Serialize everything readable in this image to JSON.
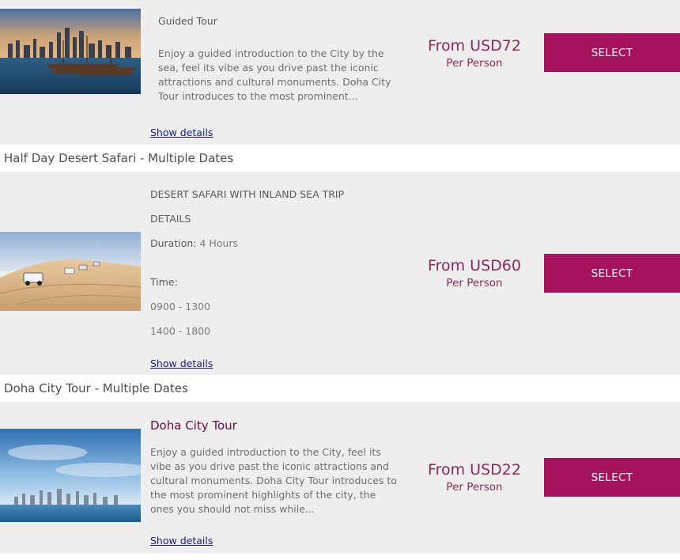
{
  "tours": [
    {
      "subtitle": "Guided Tour",
      "description": "Enjoy a guided introduction to the City by the sea, feel its vibe as you drive past the iconic attractions and cultural monuments. Doha City Tour introduces to the most prominent...",
      "show_details": "Show details",
      "price_from": "From USD72",
      "price_per": "Per Person",
      "select_label": "SELECT",
      "image": "doha-harbor-skyline-photo"
    },
    {
      "section_title": "Half Day Desert Safari - Multiple Dates",
      "line1": "DESERT SAFARI WITH INLAND SEA TRIP",
      "line2": "DETAILS",
      "duration_label": "Duration:",
      "duration_value": "4 Hours",
      "time_label": "Time:",
      "time1": "0900 - 1300",
      "time2": "1400 - 1800",
      "show_details": "Show details",
      "price_from": "From USD60",
      "price_per": "Per Person",
      "select_label": "SELECT",
      "image": "desert-dunes-4x4-photo"
    },
    {
      "section_title": "Doha City Tour - Multiple Dates",
      "title": "Doha City Tour",
      "description": "Enjoy a guided introduction to the City, feel its vibe as you drive past the iconic attractions and cultural monuments. Doha City Tour introduces to the most prominent highlights of the city, the ones you should not miss while...",
      "show_details": "Show details",
      "price_from": "From USD22",
      "price_per": "Per Person",
      "select_label": "SELECT",
      "image": "doha-skyline-sky-photo"
    }
  ],
  "colors": {
    "accent": "#a5135c",
    "price": "#8c2a55",
    "card_bg": "#eeeeee"
  }
}
